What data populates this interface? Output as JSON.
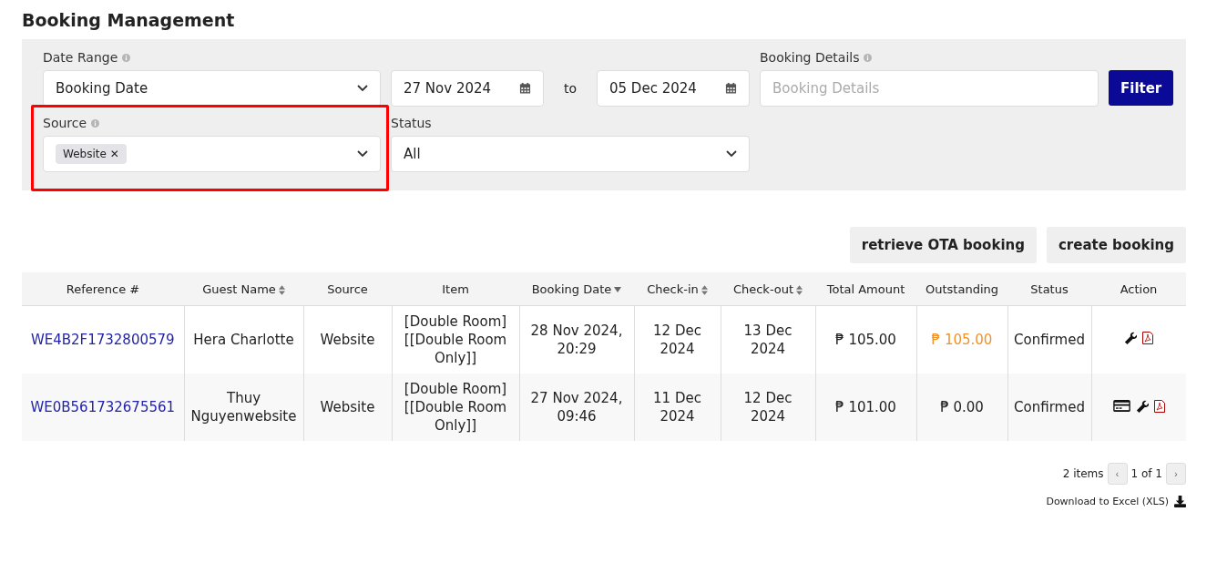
{
  "page_title": "Booking Management",
  "filters": {
    "date_range": {
      "label": "Date Range",
      "value": "Booking Date"
    },
    "date_from": "27 Nov 2024",
    "date_sep": "to",
    "date_to": "05 Dec 2024",
    "booking_details": {
      "label": "Booking Details",
      "placeholder": "Booking Details"
    },
    "filter_button": "Filter",
    "source": {
      "label": "Source",
      "highlighted": true,
      "tags": [
        "Website"
      ],
      "tag_remove": "✕"
    },
    "status": {
      "label": "Status",
      "value": "All"
    }
  },
  "actions": [
    "retrieve OTA booking",
    "create booking"
  ],
  "table": {
    "columns": [
      {
        "label": "Reference #"
      },
      {
        "label": "Guest Name",
        "sortable": true,
        "sorted": false
      },
      {
        "label": "Source"
      },
      {
        "label": "Item"
      },
      {
        "label": "Booking Date",
        "sortable": true,
        "sorted": true
      },
      {
        "label": "Check-in",
        "sortable": true,
        "sorted": false
      },
      {
        "label": "Check-out",
        "sortable": true,
        "sorted": false
      },
      {
        "label": "Total Amount"
      },
      {
        "label": "Outstanding"
      },
      {
        "label": "Status"
      },
      {
        "label": "Action"
      }
    ],
    "rows": [
      {
        "reference": "WE4B2F1732800579",
        "guest": "Hera Charlotte",
        "source": "Website",
        "item": "[Double Room] [[Double Room Only]]",
        "booking_date": "28 Nov 2024, 20:29",
        "check_in": "12 Dec 2024",
        "check_out": "13 Dec 2024",
        "total": "₱ 105.00",
        "outstanding": "₱ 105.00",
        "outstanding_due": true,
        "status": "Confirmed",
        "actions": [
          {
            "kind": "wrench"
          },
          {
            "kind": "pdf"
          }
        ]
      },
      {
        "reference": "WE0B561732675561",
        "guest": "Thuy Nguyenwebsite",
        "source": "Website",
        "item": "[Double Room] [[Double Room Only]]",
        "booking_date": "27 Nov 2024, 09:46",
        "check_in": "11 Dec 2024",
        "check_out": "12 Dec 2024",
        "total": "₱ 101.00",
        "outstanding": "₱ 0.00",
        "outstanding_due": false,
        "status": "Confirmed",
        "actions": [
          {
            "kind": "card"
          },
          {
            "kind": "wrench"
          },
          {
            "kind": "pdf"
          }
        ]
      }
    ]
  },
  "pagination": {
    "count": "2 items",
    "prev": "‹",
    "page": "1 of 1",
    "next": "›"
  },
  "download": "Download to Excel (XLS)"
}
